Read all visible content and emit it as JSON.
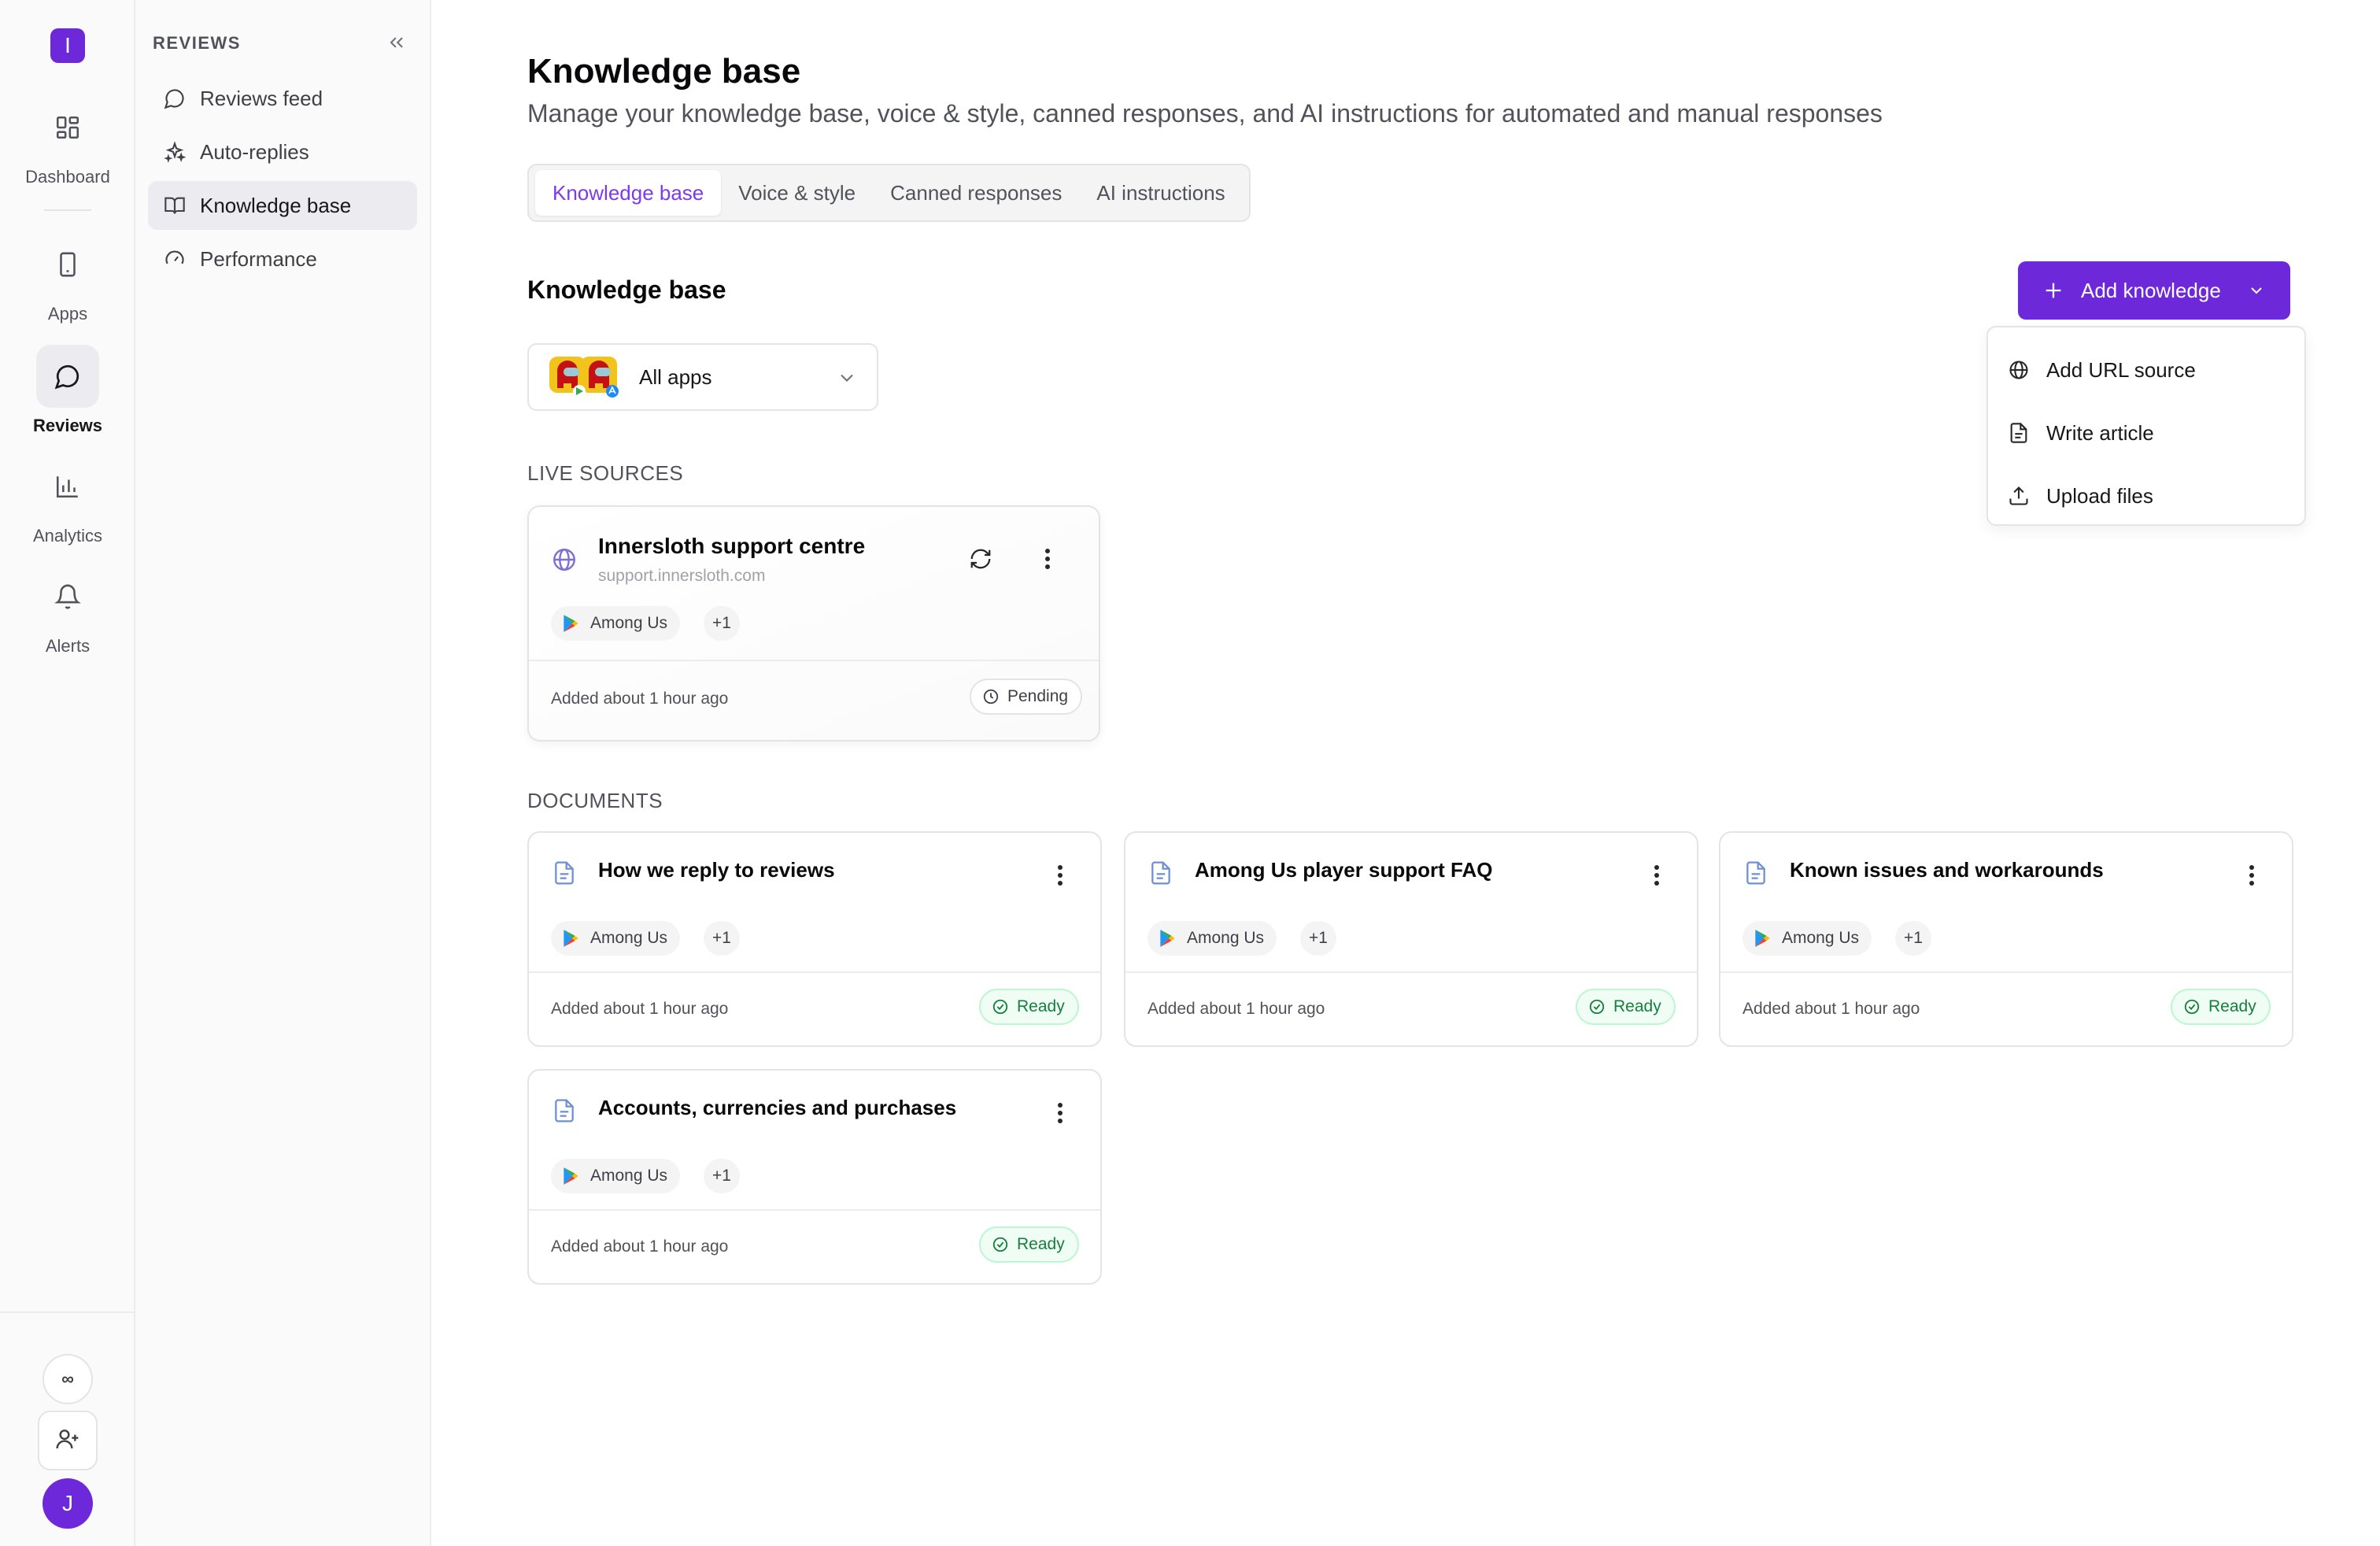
{
  "rail": {
    "logo_letter": "I",
    "items": [
      {
        "label": "Dashboard",
        "icon": "dashboard-icon"
      },
      {
        "label": "Apps",
        "icon": "phone-icon"
      },
      {
        "label": "Reviews",
        "icon": "chat-bubble-icon"
      },
      {
        "label": "Analytics",
        "icon": "bar-chart-icon"
      },
      {
        "label": "Alerts",
        "icon": "bell-icon"
      }
    ],
    "infinity_glyph": "∞",
    "avatar_letter": "J"
  },
  "sidebar": {
    "heading": "REVIEWS",
    "items": [
      {
        "label": "Reviews feed",
        "icon": "chat-bubble-icon"
      },
      {
        "label": "Auto-replies",
        "icon": "sparkle-icon"
      },
      {
        "label": "Knowledge base",
        "icon": "book-icon"
      },
      {
        "label": "Performance",
        "icon": "gauge-icon"
      }
    ]
  },
  "header": {
    "title": "Knowledge base",
    "subtitle": "Manage your knowledge base, voice & style, canned responses, and AI instructions for automated and manual responses"
  },
  "tabs": [
    {
      "label": "Knowledge base"
    },
    {
      "label": "Voice & style"
    },
    {
      "label": "Canned responses"
    },
    {
      "label": "AI instructions"
    }
  ],
  "section": {
    "title": "Knowledge base",
    "add_button": "Add knowledge"
  },
  "menu": {
    "items": [
      {
        "label": "Add URL source",
        "icon": "globe-icon"
      },
      {
        "label": "Write article",
        "icon": "document-icon"
      },
      {
        "label": "Upload files",
        "icon": "upload-icon"
      }
    ]
  },
  "app_select": {
    "value": "All apps"
  },
  "live_sources": {
    "label": "LIVE SOURCES",
    "cards": [
      {
        "title": "Innersloth support centre",
        "url": "support.innersloth.com",
        "app": "Among Us",
        "more": "+1",
        "added": "Added about 1 hour ago",
        "status": "Pending"
      }
    ]
  },
  "documents": {
    "label": "DOCUMENTS",
    "cards": [
      {
        "title": "How we reply to reviews",
        "app": "Among Us",
        "more": "+1",
        "added": "Added about 1 hour ago",
        "status": "Ready"
      },
      {
        "title": "Among Us player support FAQ",
        "app": "Among Us",
        "more": "+1",
        "added": "Added about 1 hour ago",
        "status": "Ready"
      },
      {
        "title": "Known issues and workarounds",
        "app": "Among Us",
        "more": "+1",
        "added": "Added about 1 hour ago",
        "status": "Ready"
      },
      {
        "title": "Accounts, currencies and purchases",
        "app": "Among Us",
        "more": "+1",
        "added": "Added about 1 hour ago",
        "status": "Ready"
      }
    ]
  },
  "colors": {
    "brand": "#6d28d9",
    "tab_active": "#7c3aed",
    "ready": "#15803d"
  }
}
